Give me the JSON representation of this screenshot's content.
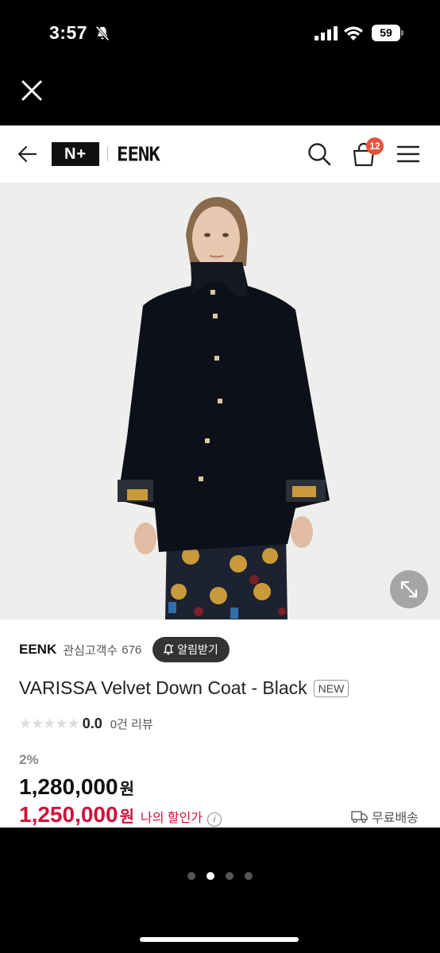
{
  "status_bar": {
    "time": "3:57",
    "battery": "59"
  },
  "header": {
    "logo_primary": "N+",
    "logo_brand": "EENK",
    "cart_count": "12"
  },
  "product": {
    "brand": "EENK",
    "followers_label": "관심고객수",
    "followers_count": "676",
    "notify_label": "알림받기",
    "title": "VARISSA Velvet Down Coat - Black",
    "new_badge": "NEW",
    "rating": "0.0",
    "reviews": "0건 리뷰",
    "discount": "2%",
    "price": "1,280,000",
    "currency": "원",
    "sale_price": "1,250,000",
    "my_discount_label": "나의 할인가",
    "shipping": "무료배송"
  },
  "pager": {
    "count": 4,
    "active": 1
  },
  "colors": {
    "sale": "#d0103a",
    "badge": "#e4533e",
    "accent_dark": "#333333"
  }
}
